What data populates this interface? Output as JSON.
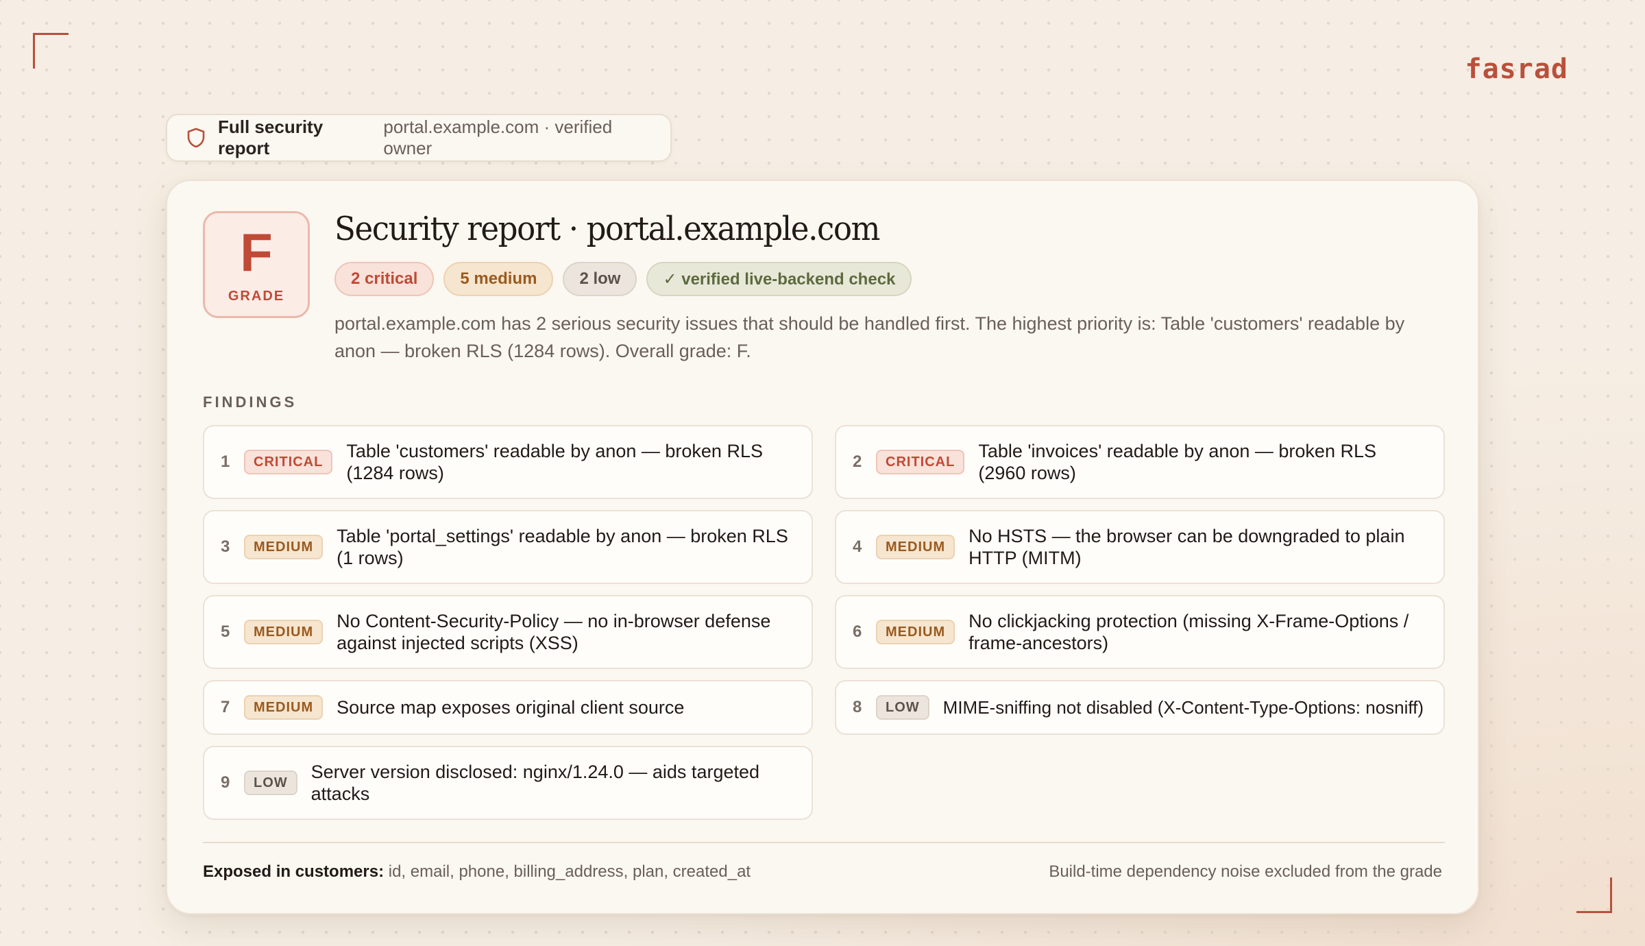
{
  "brand": {
    "name": "fasrad",
    "accent": "#b9503c"
  },
  "header_pill": {
    "icon": "shield-icon",
    "title": "Full security report",
    "subtitle": "portal.example.com · verified owner"
  },
  "report": {
    "grade": {
      "letter": "F",
      "label": "GRADE"
    },
    "title": "Security report · portal.example.com",
    "badges": {
      "critical": "2 critical",
      "medium": "5 medium",
      "low": "2 low",
      "verified": "✓ verified live-backend check"
    },
    "summary": "portal.example.com has 2 serious security issues that should be handled first. The highest priority is: Table 'customers' readable by anon — broken RLS (1284 rows). Overall grade: F.",
    "findings_label": "FINDINGS",
    "findings": [
      {
        "num": "1",
        "severity": "CRITICAL",
        "text": "Table 'customers' readable by anon — broken RLS (1284 rows)"
      },
      {
        "num": "2",
        "severity": "CRITICAL",
        "text": "Table 'invoices' readable by anon — broken RLS (2960 rows)"
      },
      {
        "num": "3",
        "severity": "MEDIUM",
        "text": "Table 'portal_settings' readable by anon — broken RLS (1 rows)"
      },
      {
        "num": "4",
        "severity": "MEDIUM",
        "text": "No HSTS — the browser can be downgraded to plain HTTP (MITM)"
      },
      {
        "num": "5",
        "severity": "MEDIUM",
        "text": "No Content-Security-Policy — no in-browser defense against injected scripts (XSS)"
      },
      {
        "num": "6",
        "severity": "MEDIUM",
        "text": "No clickjacking protection (missing X-Frame-Options / frame-ancestors)"
      },
      {
        "num": "7",
        "severity": "MEDIUM",
        "text": "Source map exposes original client source"
      },
      {
        "num": "8",
        "severity": "LOW",
        "text": "MIME-sniffing not disabled (X-Content-Type-Options: nosniff)"
      },
      {
        "num": "9",
        "severity": "LOW",
        "text": "Server version disclosed: nginx/1.24.0 — aids targeted attacks"
      }
    ],
    "footer": {
      "exposed_label": "Exposed in customers:",
      "exposed_fields": "id, email, phone, billing_address, plan, created_at",
      "note": "Build-time dependency noise excluded from the grade"
    }
  },
  "colors": {
    "critical": "#bf4a35",
    "medium": "#9a5a1e",
    "low": "#5c524b",
    "verified": "#5c6a3d"
  }
}
